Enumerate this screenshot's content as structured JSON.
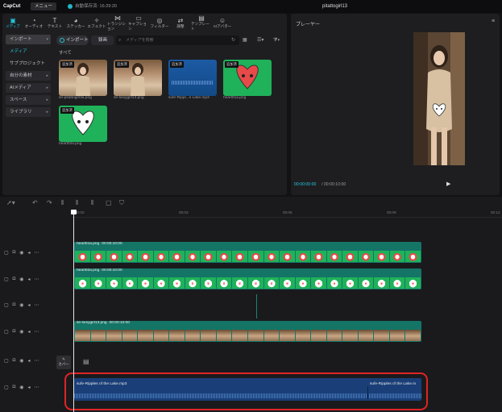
{
  "app": {
    "logo": "CapCut",
    "menu": "メニュー",
    "autosave": "自動保存済: 16:29:20",
    "project": "pitattogirl13"
  },
  "toolbar": [
    {
      "label": "メディア",
      "icon": "media-icon",
      "glyph": "▣",
      "active": true
    },
    {
      "label": "オーディオ",
      "icon": "audio-icon",
      "glyph": "◔"
    },
    {
      "label": "テキスト",
      "icon": "text-icon",
      "glyph": "T"
    },
    {
      "label": "ステッカー",
      "icon": "sticker-icon",
      "glyph": "◕"
    },
    {
      "label": "エフェクト",
      "icon": "effect-icon",
      "glyph": "✧"
    },
    {
      "label": "トランジション",
      "icon": "transition-icon",
      "glyph": "⋈"
    },
    {
      "label": "キャプション",
      "icon": "caption-icon",
      "glyph": "▭"
    },
    {
      "label": "フィルター",
      "icon": "filter-icon",
      "glyph": "◎"
    },
    {
      "label": "調整",
      "icon": "adjust-icon",
      "glyph": "⇄"
    },
    {
      "label": "テンプレート",
      "icon": "template-icon",
      "glyph": "▤"
    },
    {
      "label": "AIアバター",
      "icon": "ai-avatar-icon",
      "glyph": "☺"
    }
  ],
  "sidebar": [
    {
      "label": "インポート",
      "style": "sb",
      "id": "sb-import",
      "chev": "▾"
    },
    {
      "label": "メディア",
      "style": "sb sel",
      "chev": ""
    },
    {
      "label": "サブプロジェクト",
      "style": "sb plain",
      "chev": ""
    },
    {
      "label": "自分の素材",
      "style": "sb",
      "chev": "▸"
    },
    {
      "label": "AIメディア",
      "style": "sb",
      "chev": "▸"
    },
    {
      "label": "スペース",
      "style": "sb",
      "chev": "▸"
    },
    {
      "label": "ライブラリ",
      "style": "sb",
      "chev": "▸"
    }
  ],
  "media": {
    "import_tab": "インポート",
    "record_tab": "録画",
    "search_placeholder": "メディアを検索",
    "all_label": "すべて"
  },
  "cards": [
    {
      "name": "se-pitattogirl3a.png",
      "badge": "追加済",
      "kind": "woman",
      "color": "#b79272"
    },
    {
      "name": "se-sexygirl13.png",
      "badge": "追加済",
      "kind": "woman",
      "color": "#b79272"
    },
    {
      "name": "sufe-Rippl...e Lake.mp3",
      "badge": "追加済",
      "kind": "audio",
      "color": "#1c5aa3"
    },
    {
      "name": "heart01a.png",
      "badge": "追加済",
      "kind": "heartbg",
      "color": "#1fb25a"
    },
    {
      "name": "heart02a.png",
      "badge": "追加済",
      "kind": "heartbg",
      "color": "#1fb25a"
    }
  ],
  "player": {
    "title": "プレーヤー",
    "timecode": "00:00:00:00",
    "duration": "/ 00:00:10:00"
  },
  "ruler": [
    "00:00",
    "00:03",
    "00:06",
    "00:09",
    "00:12"
  ],
  "tracks": [
    {
      "label": "heart01a.png",
      "time": "00:00:10:00",
      "frame": "fh"
    },
    {
      "label": "heart02a.png",
      "time": "00:00:10:00",
      "frame": "fh2"
    },
    {
      "label": "",
      "time": "",
      "frame": ""
    },
    {
      "label": "se-sexygirl13.png",
      "time": "00:00:10:00",
      "frame": "fw"
    }
  ],
  "cover": {
    "label": "カバー"
  },
  "audio": {
    "name1": "sufe-Ripples of the Lake.mp3",
    "name2": "sufe-Ripples of the Lake.m"
  }
}
